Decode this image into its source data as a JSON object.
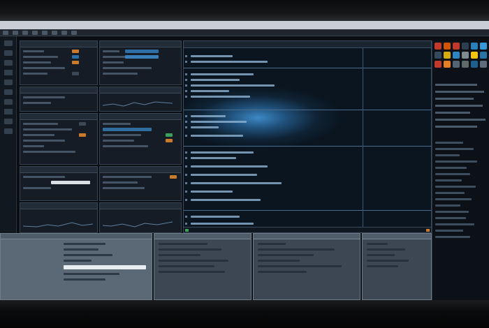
{
  "menubar": {
    "items": [
      "",
      "",
      "",
      "",
      "",
      "",
      "",
      "",
      "",
      "",
      "",
      "",
      "",
      "",
      "",
      "",
      "",
      "",
      "",
      ""
    ]
  },
  "main_editor": {
    "title": ""
  },
  "panels": [
    {
      "id": "tl-a",
      "title": ""
    },
    {
      "id": "tl-b",
      "title": ""
    },
    {
      "id": "tl-c",
      "title": ""
    },
    {
      "id": "ml-a",
      "title": ""
    },
    {
      "id": "ml-b",
      "title": ""
    },
    {
      "id": "bl-a",
      "title": ""
    },
    {
      "id": "bl-b",
      "title": ""
    }
  ],
  "bottom_panels": [
    {
      "id": "b1",
      "title": ""
    },
    {
      "id": "b2",
      "title": ""
    },
    {
      "id": "b3",
      "title": ""
    },
    {
      "id": "b4",
      "title": ""
    }
  ],
  "colors": {
    "accent_blue": "#3d89c6",
    "panel_bg": "#151c25",
    "panel_border": "#364453",
    "menubar_bg": "#c9ced4",
    "highlight_orange": "#c97a2a",
    "highlight_green": "#3aa05a",
    "highlight_yellow": "#c8b23a"
  },
  "swatches": [
    "#c0392b",
    "#d35400",
    "#c0392b",
    "#2c3e50",
    "#2980b9",
    "#3498db",
    "#34495e",
    "#d4ac0d",
    "#2e86c1",
    "#7f8c8d",
    "#f1c40f",
    "#2874a6",
    "#c0392b",
    "#e67e22",
    "#566573",
    "#616a6b",
    "#1f618d",
    "#5d6d7e"
  ],
  "icons": [
    "menu-icon",
    "gear-icon",
    "folder-icon",
    "play-icon",
    "search-icon",
    "chevron-right-icon"
  ]
}
